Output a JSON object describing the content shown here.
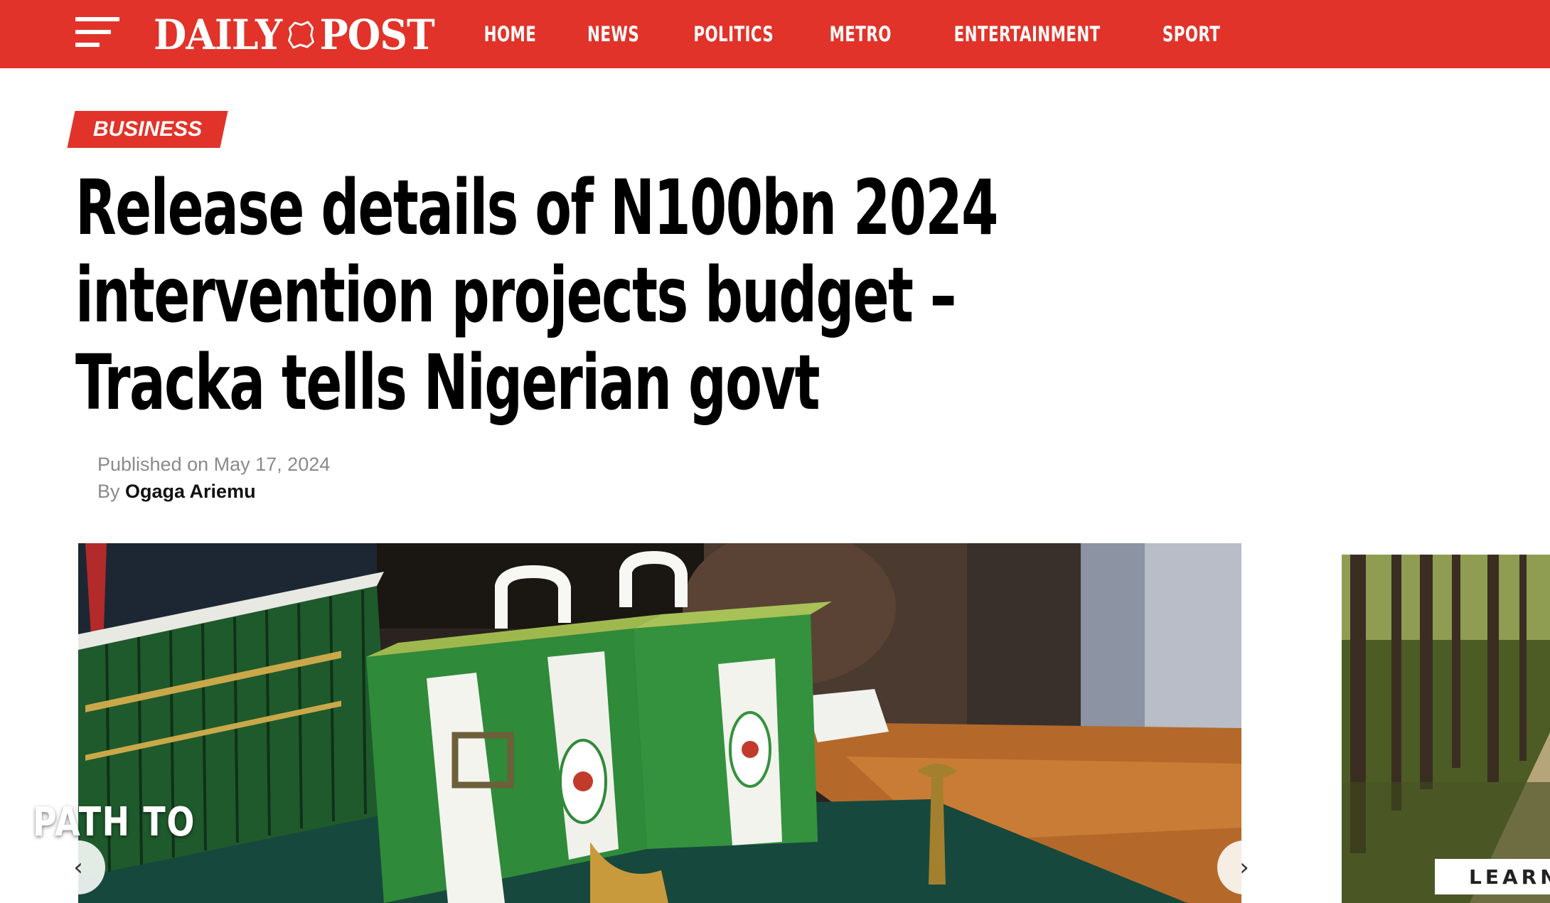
{
  "header": {
    "logo_left": "DAILY",
    "logo_right": "POST",
    "nav": [
      "HOME",
      "NEWS",
      "POLITICS",
      "METRO",
      "ENTERTAINMENT",
      "SPORT"
    ],
    "bar_color": "#e13329"
  },
  "article": {
    "category": "BUSINESS",
    "headline": "Release details of N100bn 2024 intervention projects budget – Tracka tells Nigerian govt",
    "published_label": "Published on",
    "published_date": "May 17, 2024",
    "by_label": "By",
    "author": "Ogaga Ariemu"
  },
  "gallery": {
    "prev_icon": "‹",
    "next_icon": "›"
  },
  "ad": {
    "title": "PATH TO",
    "cta": "LEARN"
  }
}
